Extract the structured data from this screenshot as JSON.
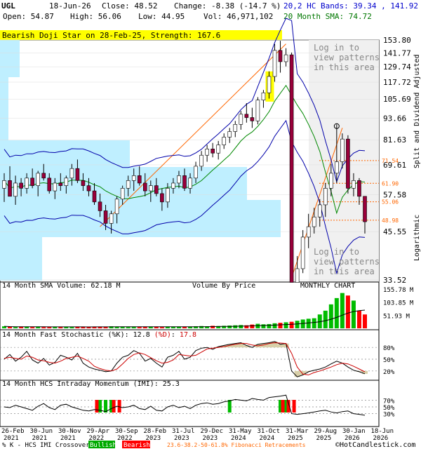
{
  "header": {
    "symbol": "UGL",
    "date": "18-Jun-26",
    "close": "Close: 48.52",
    "change": "Change: -8.38 (-14.7 %)",
    "open": "Open: 54.87",
    "high": "High: 56.06",
    "low": "Low: 44.95",
    "volume": "Vol: 46,971,102",
    "bands": "20,2 HC Bands: 39.34 , 141.92",
    "sma": "20 Month SMA: 74.72"
  },
  "pattern_banner": "Bearish Doji Star on 28-Feb-25, Strength: 167.6",
  "watermark": "Log in to\nview patterns\nin this area",
  "right_axis_label": "Split and Dividend Adjusted",
  "log_label": "Logarithmic",
  "chart_data": [
    {
      "type": "candlestick",
      "title": "",
      "scale": "log",
      "price_ticks": [
        153.8,
        141.77,
        129.74,
        117.72,
        105.69,
        93.66,
        81.63,
        69.61,
        57.58,
        45.55,
        33.52
      ],
      "fib_levels": [
        {
          "label": "71.54",
          "value": 71.54
        },
        {
          "label": "61.90",
          "value": 61.9
        },
        {
          "label": "55.06",
          "value": 55.06
        },
        {
          "label": "48.98",
          "value": 48.98
        }
      ],
      "candles_ohlc": [
        [
          60,
          66,
          55,
          63
        ],
        [
          63,
          69,
          58,
          57
        ],
        [
          57,
          65,
          54,
          62
        ],
        [
          62,
          64,
          57,
          60
        ],
        [
          60,
          66,
          58,
          64
        ],
        [
          64,
          68,
          60,
          61
        ],
        [
          61,
          67,
          57,
          66
        ],
        [
          66,
          70,
          63,
          64
        ],
        [
          64,
          66,
          58,
          59
        ],
        [
          59,
          64,
          56,
          62
        ],
        [
          62,
          66,
          59,
          61
        ],
        [
          61,
          65,
          58,
          64
        ],
        [
          64,
          70,
          61,
          68
        ],
        [
          68,
          72,
          62,
          63
        ],
        [
          63,
          66,
          59,
          61
        ],
        [
          61,
          64,
          57,
          59
        ],
        [
          59,
          62,
          54,
          55
        ],
        [
          55,
          58,
          50,
          52
        ],
        [
          52,
          54,
          46,
          48
        ],
        [
          48,
          52,
          45,
          51
        ],
        [
          51,
          57,
          48,
          56
        ],
        [
          56,
          61,
          54,
          60
        ],
        [
          60,
          65,
          57,
          63
        ],
        [
          63,
          68,
          59,
          65
        ],
        [
          65,
          69,
          61,
          62
        ],
        [
          62,
          66,
          57,
          59
        ],
        [
          59,
          63,
          55,
          61
        ],
        [
          61,
          64,
          57,
          58
        ],
        [
          58,
          60,
          52,
          55
        ],
        [
          55,
          62,
          53,
          60
        ],
        [
          60,
          64,
          58,
          62
        ],
        [
          62,
          67,
          60,
          65
        ],
        [
          65,
          68,
          59,
          60
        ],
        [
          60,
          66,
          58,
          64
        ],
        [
          64,
          71,
          62,
          69
        ],
        [
          69,
          76,
          67,
          74
        ],
        [
          74,
          79,
          71,
          77
        ],
        [
          77,
          80,
          73,
          75
        ],
        [
          75,
          81,
          72,
          79
        ],
        [
          79,
          85,
          77,
          83
        ],
        [
          83,
          88,
          80,
          86
        ],
        [
          86,
          92,
          83,
          90
        ],
        [
          90,
          98,
          87,
          96
        ],
        [
          96,
          103,
          91,
          94
        ],
        [
          94,
          100,
          88,
          92
        ],
        [
          92,
          107,
          90,
          105
        ],
        [
          105,
          112,
          100,
          110
        ],
        [
          110,
          126,
          106,
          122
        ],
        [
          122,
          150,
          118,
          144
        ],
        [
          144,
          153,
          125,
          134
        ],
        [
          134,
          146,
          130,
          140
        ],
        [
          140,
          142,
          33,
          33
        ],
        [
          33,
          39,
          33,
          36
        ],
        [
          36,
          46,
          35,
          44
        ],
        [
          44,
          51,
          41,
          47
        ],
        [
          47,
          53,
          45,
          50
        ],
        [
          50,
          56,
          47,
          54
        ],
        [
          54,
          62,
          50,
          60
        ],
        [
          60,
          70,
          57,
          66
        ],
        [
          66,
          90,
          62,
          71
        ],
        [
          71,
          85,
          68,
          82
        ],
        [
          82,
          84,
          58,
          60
        ],
        [
          60,
          66,
          57,
          63
        ],
        [
          63,
          64,
          54,
          57
        ],
        [
          57,
          56,
          45,
          48.5
        ]
      ],
      "x_labels": [
        "26-Feb\n2021",
        "30-Jun\n2021",
        "30-Nov\n2021",
        "29-Apr\n2022",
        "30-Sep\n2022",
        "28-Feb\n2023",
        "31-Jul\n2023",
        "29-Dec\n2023",
        "31-May\n2024",
        "31-Oct\n2024",
        "31-Mar\n2025",
        "29-Aug\n2025",
        "30-Jan\n2026",
        "18-Jun\n2026"
      ]
    },
    {
      "type": "bar",
      "title": "14 Month SMA Volume: 62.18 M",
      "center_label": "Volume By Price",
      "right_label": "MONTHLY CHART",
      "ticks": [
        155.78,
        103.85,
        51.93
      ],
      "tick_labels": [
        "155.78 M",
        "103.85 M",
        "51.93 M"
      ],
      "values": [
        8,
        6,
        5,
        7,
        6,
        5,
        6,
        5,
        5,
        6,
        5,
        6,
        5,
        7,
        6,
        5,
        6,
        7,
        6,
        8,
        7,
        6,
        5,
        6,
        5,
        6,
        7,
        6,
        5,
        7,
        6,
        6,
        7,
        6,
        8,
        9,
        8,
        10,
        9,
        10,
        11,
        12,
        13,
        12,
        15,
        18,
        16,
        17,
        20,
        22,
        24,
        26,
        30,
        35,
        38,
        40,
        55,
        70,
        95,
        120,
        140,
        130,
        110,
        70,
        55
      ]
    },
    {
      "type": "line",
      "title": "14 Month Fast Stochastic (%K)",
      "k_label": "(%K)",
      "d_label": "(%D)",
      "k_value": "12.8",
      "d_value": "17.8",
      "ticks": [
        "80%",
        "50%",
        "20%"
      ],
      "k_values": [
        50,
        62,
        45,
        55,
        70,
        48,
        40,
        52,
        35,
        42,
        60,
        55,
        48,
        65,
        40,
        30,
        25,
        22,
        18,
        20,
        40,
        55,
        60,
        72,
        65,
        45,
        52,
        40,
        30,
        55,
        60,
        70,
        50,
        55,
        72,
        78,
        80,
        75,
        82,
        85,
        88,
        90,
        92,
        85,
        80,
        88,
        90,
        92,
        95,
        88,
        90,
        20,
        5,
        10,
        18,
        22,
        25,
        30,
        38,
        45,
        40,
        30,
        22,
        18,
        12.8
      ],
      "d_values": [
        52,
        55,
        52,
        50,
        58,
        55,
        48,
        46,
        42,
        40,
        45,
        52,
        55,
        58,
        52,
        45,
        32,
        26,
        22,
        20,
        25,
        38,
        52,
        62,
        66,
        62,
        54,
        46,
        40,
        42,
        48,
        62,
        60,
        58,
        60,
        68,
        76,
        78,
        80,
        82,
        85,
        88,
        90,
        90,
        86,
        84,
        86,
        90,
        92,
        91,
        90,
        65,
        30,
        12,
        10,
        16,
        20,
        25,
        30,
        36,
        40,
        38,
        32,
        25,
        17.8
      ]
    },
    {
      "type": "line",
      "title": "14 Month HCS Intraday Momentum (IMI): 25.3",
      "ticks": [
        "70%",
        "50%",
        "30%"
      ],
      "values": [
        50,
        48,
        55,
        50,
        45,
        40,
        52,
        60,
        48,
        42,
        55,
        58,
        50,
        45,
        40,
        38,
        42,
        40,
        36,
        45,
        52,
        48,
        50,
        55,
        45,
        42,
        52,
        40,
        38,
        50,
        55,
        48,
        52,
        45,
        55,
        60,
        62,
        58,
        60,
        65,
        68,
        72,
        70,
        68,
        75,
        72,
        70,
        78,
        80,
        82,
        85,
        30,
        28,
        30,
        32,
        35,
        38,
        40,
        35,
        32,
        36,
        38,
        30,
        28,
        25.3
      ],
      "bullish_at": [
        17,
        18,
        19,
        40,
        49,
        50
      ],
      "bearish_at": [
        16,
        19,
        20,
        49,
        50,
        51
      ]
    }
  ],
  "footer": {
    "legend_text": "% K - HCS IMI Crossover:",
    "bullish": "Bullish",
    "bearish": "Bearish",
    "fib_note": "23.6-38.2-50-61.8% Fibonacci Retracements",
    "copyright": "©HotCandlestick.com"
  },
  "colors": {
    "bull": "#ffffff",
    "bear": "#99003a",
    "upper_band": "#0000aa",
    "lower_band": "#0000aa",
    "sma": "#008800",
    "fib": "#ff6600",
    "vbp": "#bfefff",
    "volume_bull": "#00bb00",
    "volume_bear": "#ff0000",
    "stoch_k": "#000000",
    "stoch_d": "#cc0000"
  }
}
